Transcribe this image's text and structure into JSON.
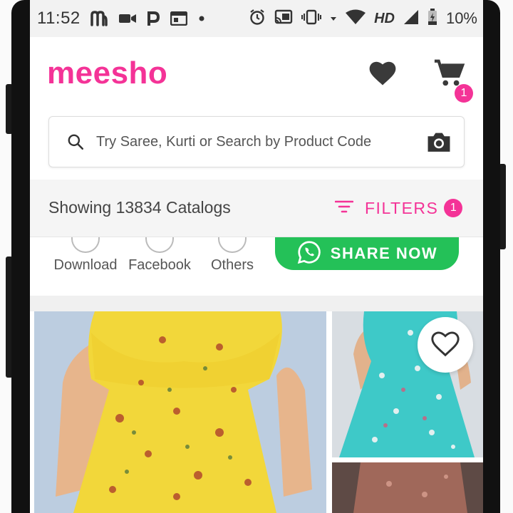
{
  "status_bar": {
    "time": "11:52",
    "network": "HD",
    "battery": "10%"
  },
  "header": {
    "logo": "meesho",
    "cart_count": "1",
    "brand_color": "#f43397"
  },
  "search": {
    "placeholder": "Try Saree, Kurti or Search by Product Code"
  },
  "results": {
    "count_text": "Showing 13834 Catalogs",
    "filters_label": "FILTERS",
    "filters_count": "1"
  },
  "share": {
    "options": [
      "Download",
      "Facebook",
      "Others"
    ],
    "share_now_label": "SHARE NOW",
    "share_color": "#24c158"
  },
  "products": {
    "items": [
      "yellow-floral-dress",
      "turquoise-floral-dress",
      "brown-floral-dress"
    ]
  }
}
